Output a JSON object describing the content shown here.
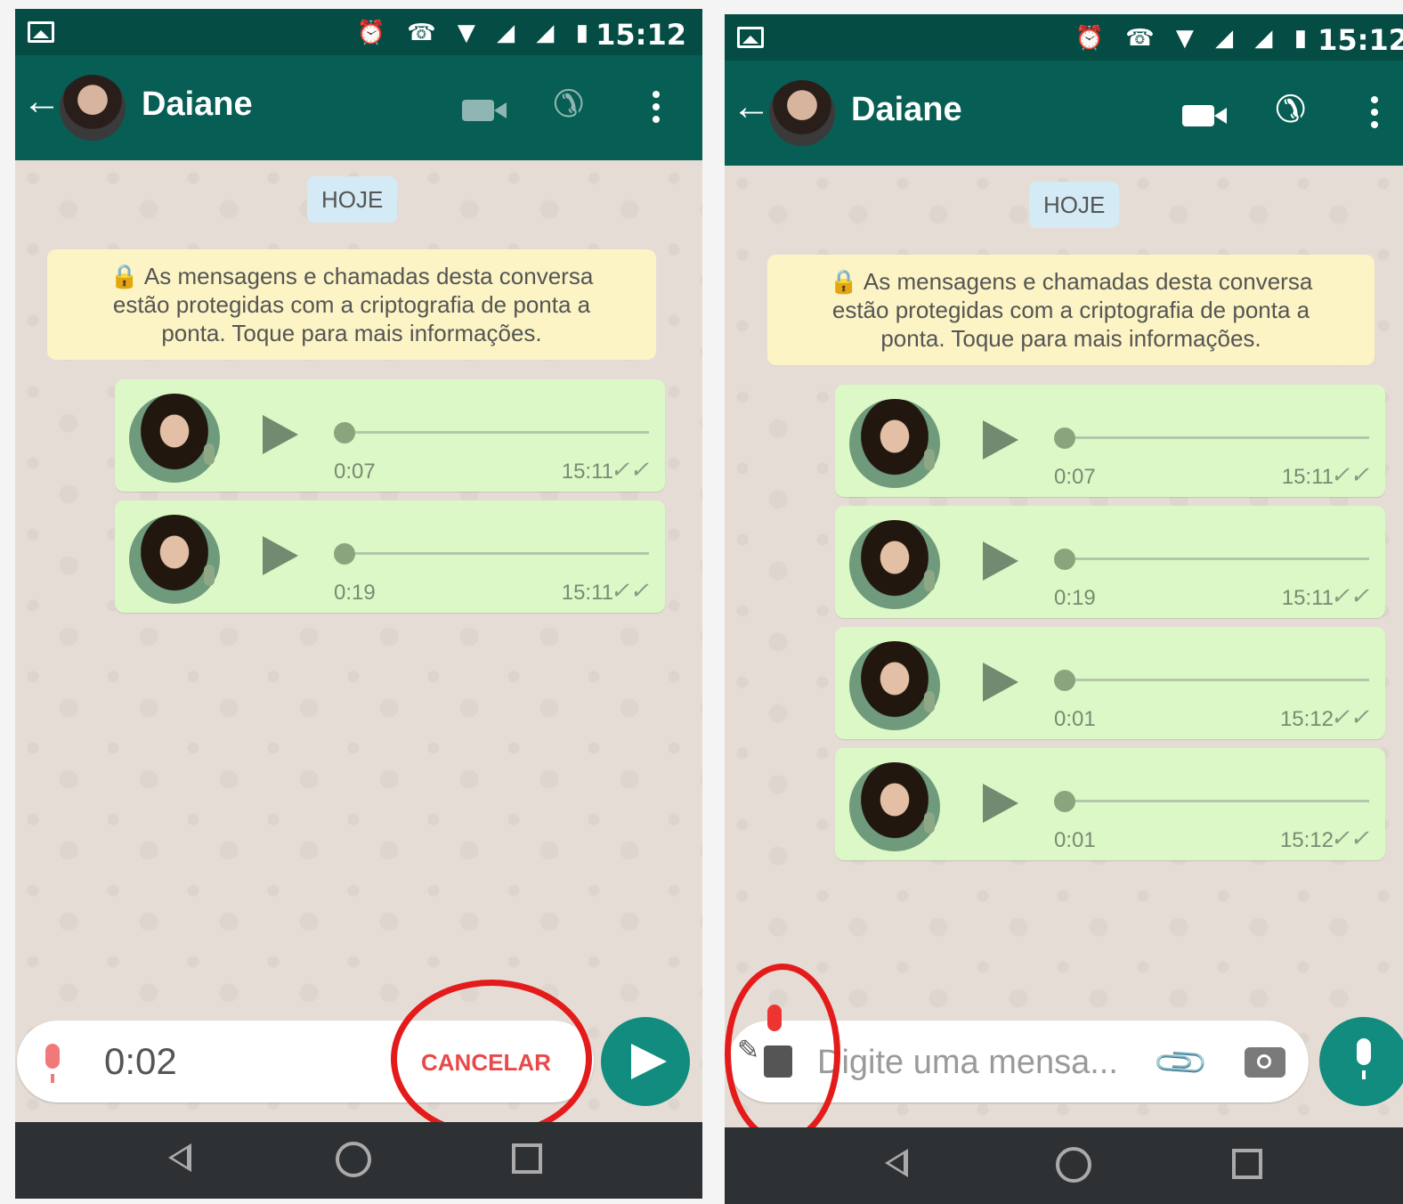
{
  "status": {
    "time": "15:12",
    "icons": "⏰ ☎ ▼ ◢ ◢ ▮"
  },
  "left": {
    "contact": "Daiane",
    "date_chip": "HOJE",
    "encryption_notice": "🔒 As mensagens e chamadas desta conversa estão protegidas com a criptografia de ponta a ponta. Toque para mais informações.",
    "messages": [
      {
        "duration": "0:07",
        "time": "15:11",
        "ticks": "✓✓"
      },
      {
        "duration": "0:19",
        "time": "15:11",
        "ticks": "✓✓"
      }
    ],
    "recording": {
      "elapsed": "0:02",
      "cancel_label": "CANCELAR"
    }
  },
  "right": {
    "contact": "Daiane",
    "date_chip": "HOJE",
    "encryption_notice": "🔒 As mensagens e chamadas desta conversa estão protegidas com a criptografia de ponta a ponta. Toque para mais informações.",
    "messages": [
      {
        "duration": "0:07",
        "time": "15:11",
        "ticks": "✓✓"
      },
      {
        "duration": "0:19",
        "time": "15:11",
        "ticks": "✓✓"
      },
      {
        "duration": "0:01",
        "time": "15:12",
        "ticks": "✓✓"
      },
      {
        "duration": "0:01",
        "time": "15:12",
        "ticks": "✓✓"
      }
    ],
    "input_placeholder": "Digite uma mensa..."
  },
  "icons": [
    "back-arrow-icon",
    "video-call-icon",
    "phone-call-icon",
    "more-menu-icon",
    "play-icon",
    "mic-icon",
    "send-icon",
    "attach-icon",
    "camera-icon",
    "stop-icon"
  ],
  "colors": {
    "header": "#075e54",
    "statusbar": "#054d44",
    "bubble": "#dcf8c6",
    "accent": "#128c7e",
    "highlight_ring": "#e41b1b"
  }
}
